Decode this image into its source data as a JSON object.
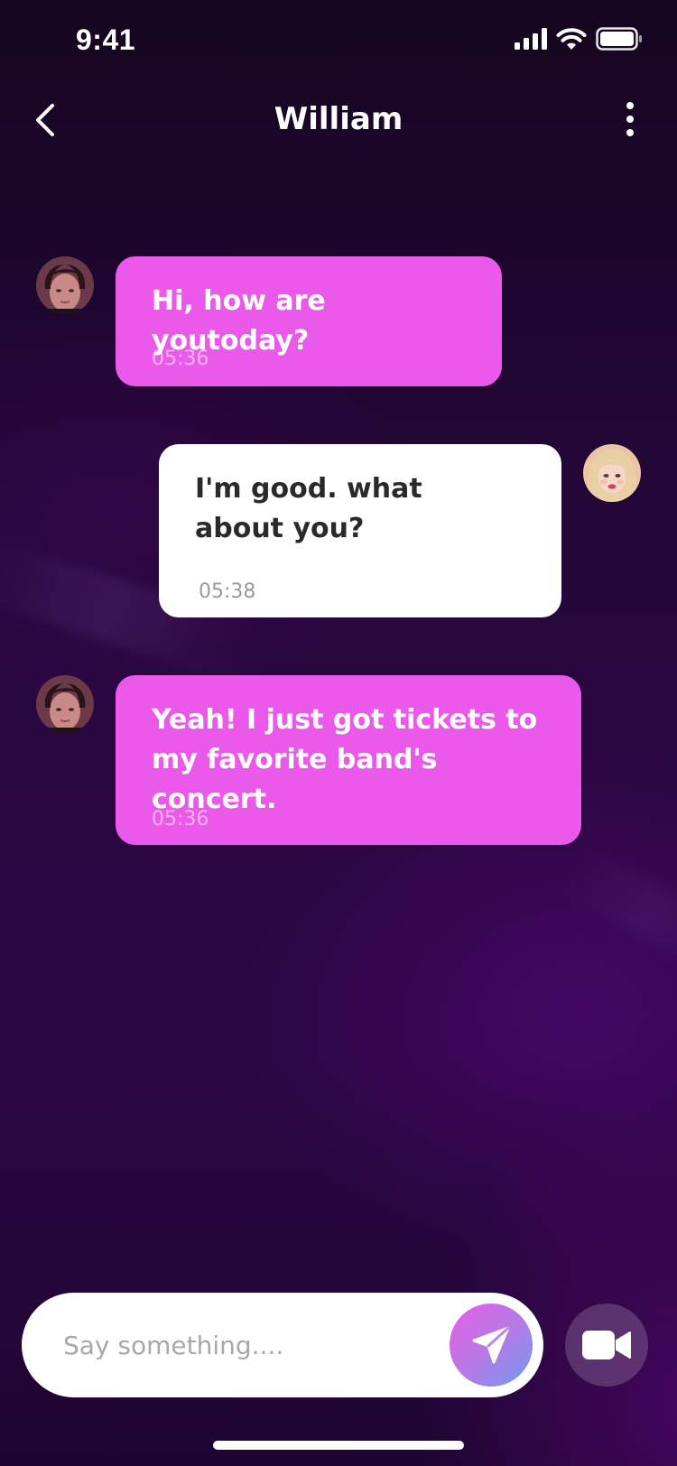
{
  "status_bar": {
    "time": "9:41",
    "icons": [
      "signal-icon",
      "wifi-icon",
      "battery-icon"
    ]
  },
  "header": {
    "title": "William",
    "back_icon": "chevron-left-icon",
    "menu_icon": "more-vertical-icon"
  },
  "messages": [
    {
      "sender": "contact",
      "text": "Hi, how are youtoday?",
      "time": "05:36"
    },
    {
      "sender": "me",
      "text": "I'm good. what about you?",
      "time": "05:38"
    },
    {
      "sender": "contact",
      "text": "Yeah! I just got tickets to my favorite band's concert.",
      "time": "05:36"
    }
  ],
  "composer": {
    "placeholder": "Say something....",
    "value": "",
    "send_icon": "send-icon",
    "video_icon": "video-camera-icon"
  },
  "colors": {
    "incoming_bubble": "#ea59ea",
    "outgoing_bubble": "#ffffff",
    "background": "#2a0742"
  }
}
